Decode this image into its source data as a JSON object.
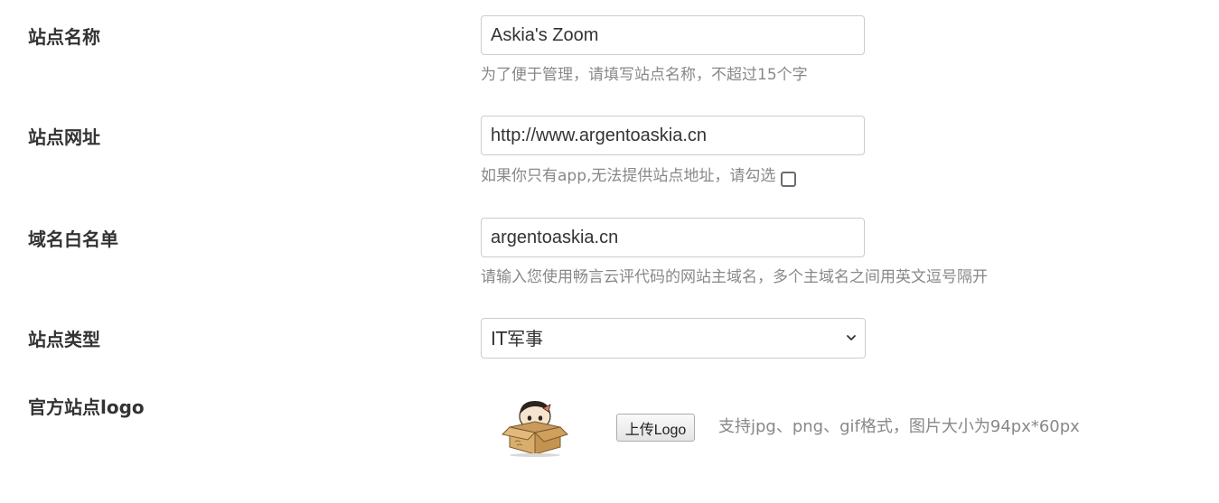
{
  "site_name": {
    "label": "站点名称",
    "value": "Askia's Zoom",
    "hint": "为了便于管理，请填写站点名称，不超过15个字"
  },
  "site_url": {
    "label": "站点网址",
    "value": "http://www.argentoaskia.cn",
    "hint": "如果你只有app,无法提供站点地址，请勾选",
    "checkbox_checked": false
  },
  "domain_whitelist": {
    "label": "域名白名单",
    "value": "argentoaskia.cn",
    "hint": "请输入您使用畅言云评代码的网站主域名，多个主域名之间用英文逗号隔开"
  },
  "site_type": {
    "label": "站点类型",
    "selected": "IT军事",
    "chevron_icon": "chevron-down-icon"
  },
  "site_logo": {
    "label": "官方站点logo",
    "image_icon": "cartoon-box-character",
    "upload_button": "上传Logo",
    "hint": "支持jpg、png、gif格式，图片大小为94px*60px"
  },
  "colors": {
    "label_text": "#333333",
    "hint_text": "#888888",
    "input_border": "#cccccc",
    "checkbox_border": "#6b6b75"
  }
}
